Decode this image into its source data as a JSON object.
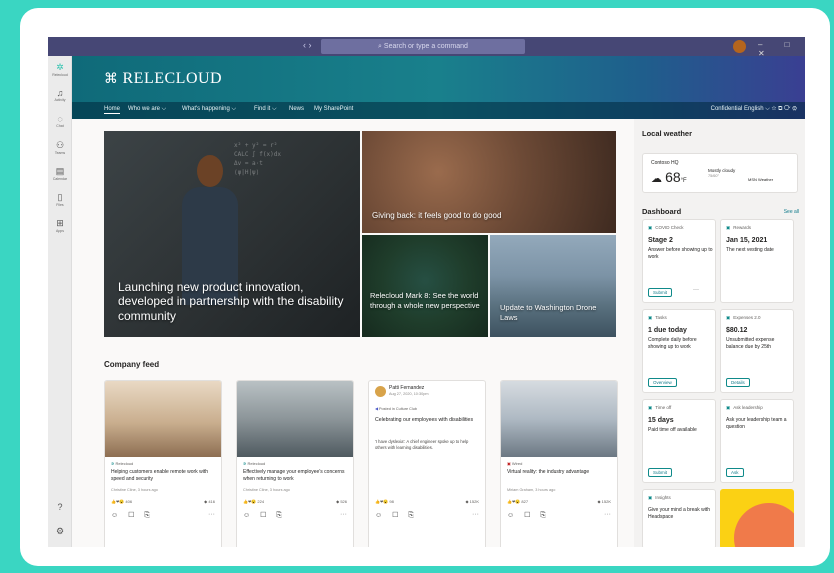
{
  "titlebar": {
    "nav_arrows": "‹ ›",
    "search_placeholder": "Search or type a command",
    "window_controls": "– □ ✕"
  },
  "rail": [
    {
      "label": "Relecloud",
      "icon": "relecloud-icon",
      "glyph": "✲"
    },
    {
      "label": "Activity",
      "icon": "bell-icon",
      "glyph": "♫"
    },
    {
      "label": "Chat",
      "icon": "chat-icon",
      "glyph": "◌"
    },
    {
      "label": "Teams",
      "icon": "teams-icon",
      "glyph": "⚇"
    },
    {
      "label": "Calendar",
      "icon": "calendar-icon",
      "glyph": "▤"
    },
    {
      "label": "Files",
      "icon": "file-icon",
      "glyph": "▯"
    },
    {
      "label": "Apps",
      "icon": "apps-icon",
      "glyph": "⊞"
    }
  ],
  "rail_bottom": [
    {
      "icon": "help-icon",
      "glyph": "?"
    },
    {
      "icon": "settings-icon",
      "glyph": "⚙"
    }
  ],
  "site": {
    "logo_mark": "⌘",
    "name": "RELECLOUD"
  },
  "nav": {
    "items": [
      "Home",
      "Who we are ⌵",
      "What's happening ⌵",
      "Find it ⌵",
      "News",
      "My SharePoint"
    ],
    "right": "Confidential   English ⌵   ☆  ⧉  ⟳  ⚙"
  },
  "hero": {
    "main": "Launching new product innovation, developed in partnership with the disability community",
    "chalk": "x² + y² = r²\nCALC ∫ f(x)dx\nΔv = a·t\n⟨ψ|H|ψ⟩",
    "kids": "Giving back: it feels good to do good",
    "forest": "Relecloud Mark 8: See the world through a whole new perspective",
    "city": "Update to Washington Drone Laws"
  },
  "feed": {
    "title": "Company feed",
    "cards": [
      {
        "source": "Relecloud",
        "title": "Helping customers enable remote work with speed and security",
        "sub": "Christine Cline, 3 hours ago",
        "reacts": "👍❤😮 406",
        "count": "◆ 416",
        "img": "linear-gradient(180deg,#e9d9c4 0%,#c9ae8e 55%,#8d6e52 100%)"
      },
      {
        "source": "Relecloud",
        "title": "Effectively manage your employee's concerns when returning to work",
        "sub": "Christine Cline, 3 hours ago",
        "reacts": "👍❤😮 224",
        "count": "◆ 526",
        "img": "linear-gradient(180deg,#b9c1c4 0%,#8c9599 50%,#4f5a60 100%)"
      },
      {
        "source": "",
        "title": "Virtual reality: the industry advantage",
        "sub": "Miriam Graham, 3 hours ago",
        "reacts": "👍❤😮 827",
        "count": "◆ 152K",
        "img": "linear-gradient(180deg,#d6dbe0 0%,#aeb9c3 50%,#6c7883 100%)"
      }
    ],
    "textpost": {
      "author": "Patti Fernandez",
      "date": "Aug 27, 2020, 10:30pm",
      "posted": "Posted in Culture Club",
      "title": "Celebrating our employees with disabilities",
      "body": "'I have dyslexia': A chief engineer spoke up to help others with learning disabilities.",
      "reacts": "👍❤😮 98",
      "count": "◆ 152K"
    },
    "vr_source": "Wired",
    "actions": "☺ ☐ ⎘",
    "more": "···"
  },
  "weather": {
    "title": "Local weather",
    "location": "Contoso HQ",
    "temp": "68",
    "unit": "°F",
    "cond": "Mostly cloudy",
    "range": "75/60°",
    "source": "MSN Weather"
  },
  "dashboard": {
    "title": "Dashboard",
    "see_all": "See all",
    "cards": [
      {
        "head": "COVID Check",
        "big": "Stage 2",
        "txt": "Answer before showing up to work",
        "btn": "Submit"
      },
      {
        "head": "Rewards",
        "big": "Jan 15, 2021",
        "txt": "The next vesting date",
        "btn": ""
      },
      {
        "head": "Tasks",
        "big": "1 due today",
        "txt": "Complete daily before showing up to work",
        "btn": "Overview"
      },
      {
        "head": "Expenses 2.0",
        "big": "$80.12",
        "txt": "Unsubmitted expense balance due by 25th",
        "btn": "Details"
      },
      {
        "head": "Time off",
        "big": "15 days",
        "txt": "Paid time off available",
        "btn": "Submit"
      },
      {
        "head": "Ask leadership",
        "big": "",
        "txt": "Ask your leadership team a question",
        "btn": "Ask"
      },
      {
        "head": "Insights",
        "big": "",
        "txt": "Give your mind a break with Headspace",
        "btn": ""
      }
    ]
  },
  "colors": {
    "accent": "#0f8a8a",
    "titlebar": "#464775",
    "page_bg": "#3ad6c2"
  }
}
